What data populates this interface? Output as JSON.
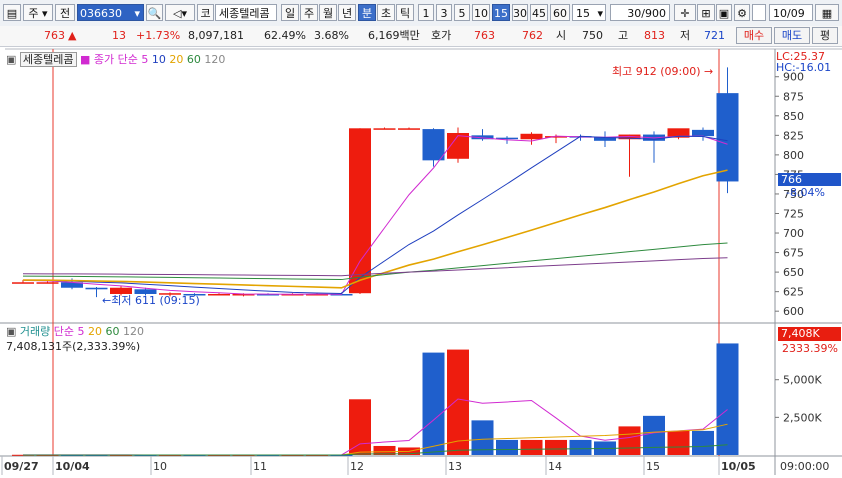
{
  "toolbar": {
    "mode1": "주",
    "mode2": "전",
    "stock_code": "036630",
    "kospi_btn": "코",
    "stock_name": "세종텔레콤",
    "periods": [
      "일",
      "주",
      "월",
      "년",
      "분",
      "초",
      "틱"
    ],
    "selected_period": "분",
    "intervals": [
      "1",
      "3",
      "5",
      "10",
      "15",
      "30",
      "45",
      "60"
    ],
    "selected_interval": "15",
    "interval_value": "15",
    "count": "30/900",
    "date": "10/09"
  },
  "quote": {
    "price": "763",
    "change": "13",
    "change_pct": "+1.73%",
    "volume": "8,097,181",
    "vol_ratio": "62.49%",
    "turnover_pct": "3.68%",
    "amount": "6,169백만",
    "bid_label": "호가",
    "ask": "763",
    "bid": "762",
    "open_label": "시",
    "open": "750",
    "high_label": "고",
    "high": "813",
    "low_label": "저",
    "low": "721",
    "buy_label": "매수",
    "sell_label": "매도",
    "eval_label": "평"
  },
  "price_pane": {
    "legend_name": "세종텔레콤",
    "ma_label": "종가 단순",
    "ma_periods": [
      "5",
      "10",
      "20",
      "60",
      "120"
    ],
    "ma_colors": [
      "#d12ad1",
      "#1f3fbf",
      "#e3a400",
      "#2e8a3e",
      "#7d3e8c"
    ],
    "high_annotation": "최고 912 (09:00)",
    "low_annotation": "최저 611 (09:15)",
    "lc_label": "LC:25.37",
    "hc_label": "HC:-16.01",
    "current_price_tag": "766",
    "current_pct_tag": "-8.04%"
  },
  "volume_pane": {
    "legend_name": "거래량",
    "ma_label": "단순",
    "ma_periods": [
      "5",
      "20",
      "60",
      "120"
    ],
    "info": "7,408,131주(2,333.39%)",
    "current_tag": "7,408K",
    "pct_tag": "2333.39%"
  },
  "x_axis": {
    "labels": [
      "09/27",
      "10/04",
      "10",
      "11",
      "12",
      "13",
      "14",
      "15",
      "10/05"
    ],
    "time_label": "09:00:00"
  },
  "chart_data": {
    "type": "candlestick",
    "y_ticks": [
      600,
      625,
      650,
      675,
      700,
      725,
      750,
      775,
      800,
      825,
      850,
      875,
      900
    ],
    "ylim": [
      590,
      915
    ],
    "volume_ticks": [
      "2,500K",
      "5,000K"
    ],
    "volume_ylim": [
      0,
      8500
    ],
    "candles": [
      {
        "o": 637,
        "h": 640,
        "l": 636,
        "c": 637
      },
      {
        "o": 637,
        "h": 638,
        "l": 636,
        "c": 637
      },
      {
        "o": 637,
        "h": 642,
        "l": 628,
        "c": 630
      },
      {
        "o": 630,
        "h": 631,
        "l": 618,
        "c": 628
      },
      {
        "o": 622,
        "h": 632,
        "l": 620,
        "c": 630
      },
      {
        "o": 628,
        "h": 630,
        "l": 620,
        "c": 622
      },
      {
        "o": 623,
        "h": 624,
        "l": 619,
        "c": 623
      },
      {
        "o": 622,
        "h": 623,
        "l": 619,
        "c": 621
      },
      {
        "o": 621,
        "h": 623,
        "l": 620,
        "c": 622
      },
      {
        "o": 621,
        "h": 623,
        "l": 619,
        "c": 622
      },
      {
        "o": 622,
        "h": 623,
        "l": 620,
        "c": 621
      },
      {
        "o": 621,
        "h": 623,
        "l": 620,
        "c": 622
      },
      {
        "o": 621,
        "h": 623,
        "l": 620,
        "c": 622
      },
      {
        "o": 622,
        "h": 624,
        "l": 620,
        "c": 621
      },
      {
        "o": 623,
        "h": 834,
        "l": 622,
        "c": 834
      },
      {
        "o": 834,
        "h": 835,
        "l": 833,
        "c": 834
      },
      {
        "o": 834,
        "h": 835,
        "l": 833,
        "c": 834
      },
      {
        "o": 833,
        "h": 834,
        "l": 785,
        "c": 793
      },
      {
        "o": 795,
        "h": 835,
        "l": 790,
        "c": 828
      },
      {
        "o": 825,
        "h": 833,
        "l": 818,
        "c": 820
      },
      {
        "o": 822,
        "h": 824,
        "l": 814,
        "c": 821
      },
      {
        "o": 820,
        "h": 829,
        "l": 813,
        "c": 827
      },
      {
        "o": 823,
        "h": 826,
        "l": 815,
        "c": 824
      },
      {
        "o": 824,
        "h": 826,
        "l": 818,
        "c": 823
      },
      {
        "o": 823,
        "h": 830,
        "l": 810,
        "c": 818
      },
      {
        "o": 820,
        "h": 826,
        "l": 772,
        "c": 826
      },
      {
        "o": 826,
        "h": 830,
        "l": 790,
        "c": 818
      },
      {
        "o": 822,
        "h": 830,
        "l": 820,
        "c": 834
      },
      {
        "o": 832,
        "h": 835,
        "l": 818,
        "c": 824
      },
      {
        "o": 879,
        "h": 912,
        "l": 751,
        "c": 766
      }
    ],
    "volumes": [
      15,
      5,
      3,
      3,
      3,
      3,
      3,
      3,
      3,
      3,
      3,
      3,
      3,
      3,
      3700,
      600,
      500,
      6800,
      7000,
      2300,
      1000,
      1000,
      1000,
      1000,
      900,
      1900,
      2600,
      1600,
      1600,
      7408
    ]
  }
}
